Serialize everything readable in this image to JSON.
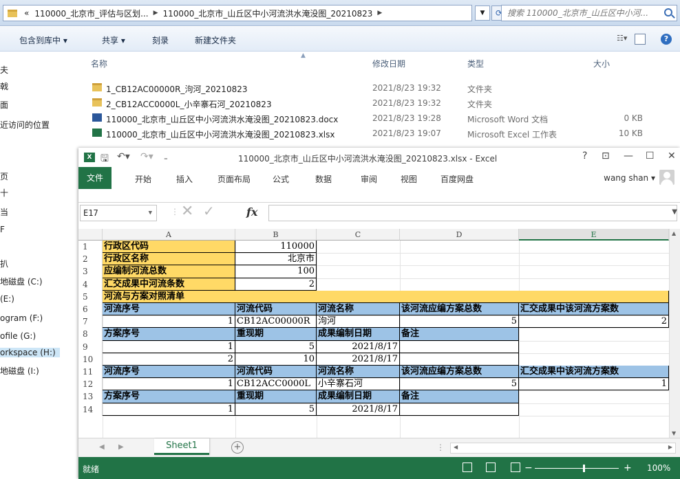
{
  "explorer": {
    "breadcrumb": [
      "«",
      "110000_北京市_评估与区划...",
      "110000_北京市_山丘区中小河流洪水淹没图_20210823"
    ],
    "search_placeholder": "搜索 110000_北京市_山丘区中小河...",
    "toolbar": {
      "include_library": "包含到库中 ▾",
      "share": "共享 ▾",
      "burn": "刻录",
      "new_folder": "新建文件夹"
    },
    "nav_items": [
      {
        "label": "夫"
      },
      {
        "label": "戟"
      },
      {
        "label": "面"
      },
      {
        "label": "近访问的位置"
      },
      {
        "label": "页"
      },
      {
        "label": "十"
      },
      {
        "label": "当"
      },
      {
        "label": "F"
      },
      {
        "label": "扒"
      },
      {
        "label": "地磁盘 (C:)"
      },
      {
        "label": "(E:)"
      },
      {
        "label": "ogram (F:)"
      },
      {
        "label": "ofile (G:)"
      },
      {
        "label": "orkspace (H:)"
      },
      {
        "label": "地磁盘 (I:)"
      }
    ],
    "columns": {
      "name": "名称",
      "date": "修改日期",
      "type": "类型",
      "size": "大小"
    },
    "files": [
      {
        "icon": "folder-icon",
        "name": "1_CB12AC00000R_泃河_20210823",
        "date": "2021/8/23 19:32",
        "type": "文件夹",
        "size": ""
      },
      {
        "icon": "folder-icon",
        "name": "2_CB12ACC0000L_小辛寨石河_20210823",
        "date": "2021/8/23 19:32",
        "type": "文件夹",
        "size": ""
      },
      {
        "icon": "word-doc-icon",
        "name": "110000_北京市_山丘区中小河流洪水淹没图_20210823.docx",
        "date": "2021/8/23 19:28",
        "type": "Microsoft Word 文档",
        "size": "0 KB"
      },
      {
        "icon": "excel-file-icon",
        "name": "110000_北京市_山丘区中小河流洪水淹没图_20210823.xlsx",
        "date": "2021/8/23 19:07",
        "type": "Microsoft Excel 工作表",
        "size": "10 KB"
      }
    ]
  },
  "excel": {
    "title": "110000_北京市_山丘区中小河流洪水淹没图_20210823.xlsx - Excel",
    "logo_text": "X",
    "win_buttons": {
      "help": "?",
      "ribbon": "⊡",
      "minimize": "—",
      "maximize": "☐",
      "close": "✕"
    },
    "tabs": [
      "文件",
      "开始",
      "插入",
      "页面布局",
      "公式",
      "数据",
      "审阅",
      "视图",
      "百度网盘"
    ],
    "user": "wang shan ▾",
    "name_box": "E17",
    "formula_icons": {
      "cancel": "✕",
      "enter": "✓",
      "fx": "fx"
    },
    "columns": [
      "A",
      "B",
      "C",
      "D",
      "E"
    ],
    "rows": [
      {
        "num": "1",
        "cells": [
          "行政区代码",
          "110000",
          "",
          "",
          ""
        ]
      },
      {
        "num": "2",
        "cells": [
          "行政区名称",
          "北京市",
          "",
          "",
          ""
        ]
      },
      {
        "num": "3",
        "cells": [
          "应编制河流总数",
          "100",
          "",
          "",
          ""
        ]
      },
      {
        "num": "4",
        "cells": [
          "汇交成果中河流条数",
          "2",
          "",
          "",
          ""
        ]
      },
      {
        "num": "5",
        "cells": [
          "河流与方案对照清单",
          "",
          "",
          "",
          ""
        ]
      },
      {
        "num": "6",
        "cells": [
          "河流序号",
          "河流代码",
          "河流名称",
          "该河流应编方案总数",
          "汇交成果中该河流方案数"
        ]
      },
      {
        "num": "7",
        "cells": [
          "1",
          "CB12AC00000R",
          "泃河",
          "5",
          "2"
        ]
      },
      {
        "num": "8",
        "cells": [
          "方案序号",
          "重现期",
          "成果编制日期",
          "备注",
          ""
        ]
      },
      {
        "num": "9",
        "cells": [
          "1",
          "5",
          "2021/8/17",
          "",
          ""
        ]
      },
      {
        "num": "10",
        "cells": [
          "2",
          "10",
          "2021/8/17",
          "",
          ""
        ]
      },
      {
        "num": "11",
        "cells": [
          "河流序号",
          "河流代码",
          "河流名称",
          "该河流应编方案总数",
          "汇交成果中该河流方案数"
        ]
      },
      {
        "num": "12",
        "cells": [
          "1",
          "CB12ACC0000L",
          "小辛寨石河",
          "5",
          "1"
        ]
      },
      {
        "num": "13",
        "cells": [
          "方案序号",
          "重现期",
          "成果编制日期",
          "备注",
          ""
        ]
      },
      {
        "num": "14",
        "cells": [
          "1",
          "5",
          "2021/8/17",
          "",
          ""
        ]
      }
    ],
    "sheet_tab": "Sheet1",
    "add_sheet": "+",
    "status": "就绪",
    "zoom": "100%",
    "colors": {
      "accent": "#217346",
      "yellow_fill": "#ffd966",
      "blue_fill": "#9dc3e6"
    }
  }
}
